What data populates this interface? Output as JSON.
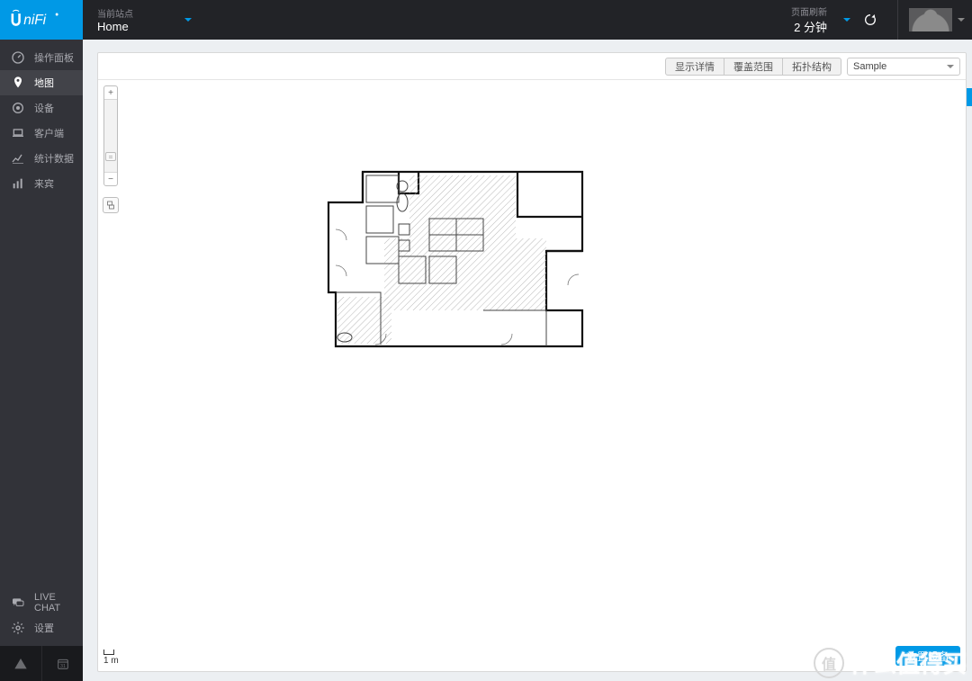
{
  "topbar": {
    "site_label": "当前站点",
    "site_name": "Home",
    "refresh_label": "页面刷新",
    "refresh_value": "2 分钟"
  },
  "sidebar": {
    "items": [
      {
        "label": "操作面板"
      },
      {
        "label": "地图"
      },
      {
        "label": "设备"
      },
      {
        "label": "客户端"
      },
      {
        "label": "统计数据"
      },
      {
        "label": "来宾"
      }
    ],
    "live_chat": "LIVE CHAT",
    "settings": "设置"
  },
  "map": {
    "buttons": {
      "detail": "显示详情",
      "coverage": "覆盖范围",
      "topology": "拓扑结构"
    },
    "select_value": "Sample",
    "zoom_plus": "+",
    "zoom_minus": "−",
    "scale_label": "1 m",
    "place_device": "放置设备"
  },
  "watermark": {
    "icon": "值",
    "text": "什么值得买"
  }
}
